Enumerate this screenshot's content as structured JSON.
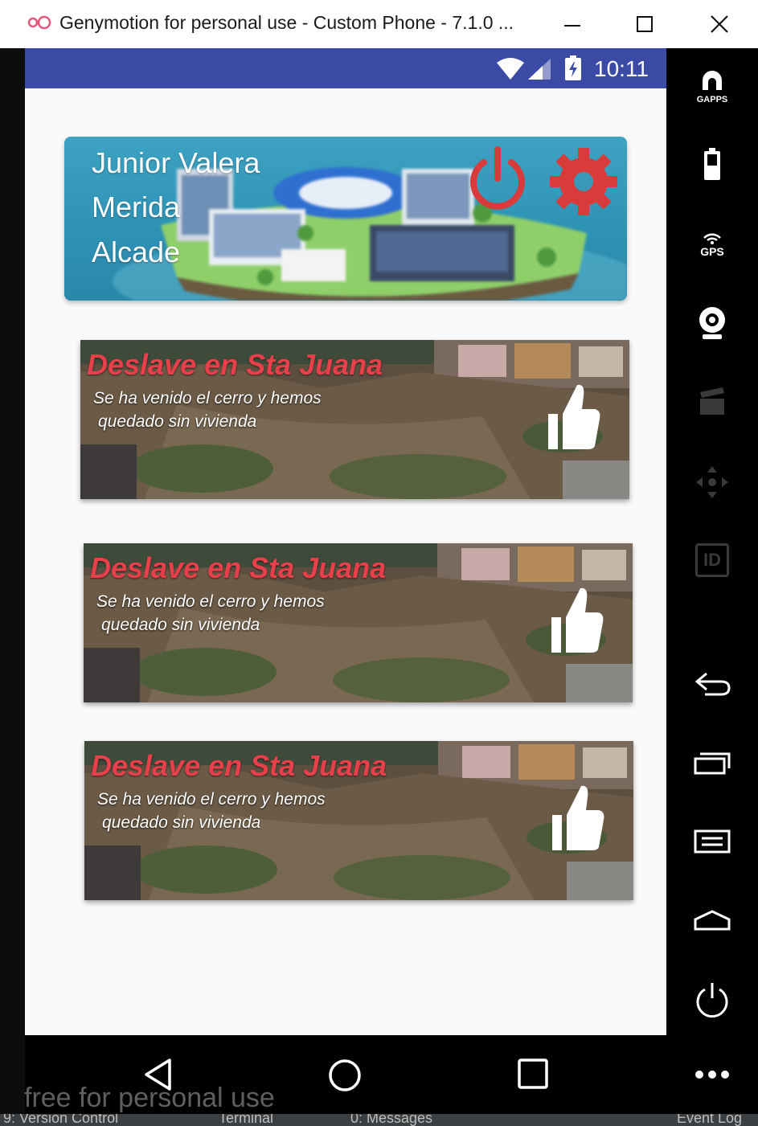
{
  "window": {
    "title": "Genymotion for personal use - Custom Phone - 7.1.0 ...",
    "logo_icon": "genymotion-logo-icon",
    "controls": [
      "minimize-icon",
      "maximize-icon",
      "close-icon"
    ]
  },
  "status_bar": {
    "time": "10:11",
    "bar_color": "#3b4ba5"
  },
  "profile": {
    "name": "Junior Valera",
    "city": "Merida",
    "role": "Alcade",
    "actions": [
      "power-icon",
      "gear-icon"
    ],
    "accent_color": "#d93a3a"
  },
  "news": [
    {
      "title": "Deslave en Sta Juana",
      "line1": "Se ha venido el cerro y hemos",
      "line2": "quedado sin vivienda",
      "action_icon": "thumbs-up-icon"
    },
    {
      "title": "Deslave en Sta Juana",
      "line1": "Se ha venido el cerro y hemos",
      "line2": "quedado sin vivienda",
      "action_icon": "thumbs-up-icon"
    },
    {
      "title": "Deslave en Sta Juana",
      "line1": "Se ha venido el cerro y hemos",
      "line2": "quedado sin vivienda",
      "action_icon": "thumbs-up-icon"
    }
  ],
  "toolbar": {
    "gapps_label": "GAPPS",
    "gps_label": "GPS",
    "id_label": "ID"
  },
  "watermark": "free for personal use",
  "ide": {
    "version_control": "9: Version Control",
    "terminal": "Terminal",
    "messages": "0: Messages",
    "event_log": "Event Log"
  }
}
